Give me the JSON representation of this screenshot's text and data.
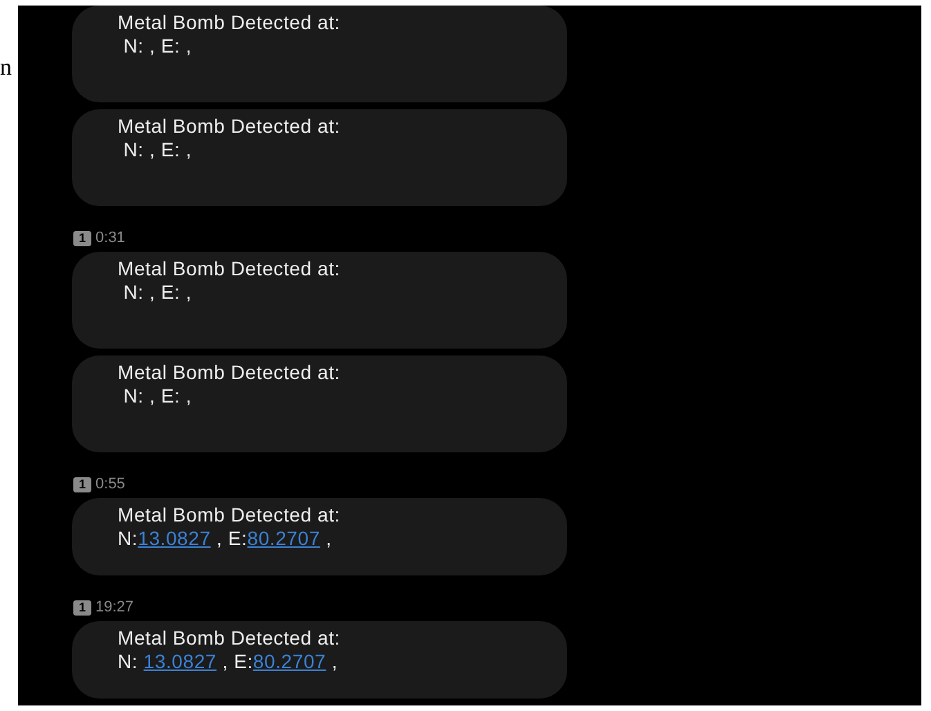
{
  "margin_text": "n",
  "messages": [
    {
      "text": "Metal Bomb Detected at:",
      "coords": [
        {
          "kind": "text",
          "text": " N: , E: ,"
        }
      ]
    },
    {
      "text": "Metal Bomb Detected at:",
      "coords": [
        {
          "kind": "text",
          "text": " N: , E: ,"
        }
      ]
    },
    {
      "sim": "1",
      "time": "0:31",
      "text": "Metal Bomb Detected at:",
      "coords": [
        {
          "kind": "text",
          "text": " N: , E: ,"
        }
      ]
    },
    {
      "text": "Metal Bomb Detected at:",
      "coords": [
        {
          "kind": "text",
          "text": " N: , E: ,"
        }
      ]
    },
    {
      "sim": "1",
      "time": "0:55",
      "text": "Metal Bomb Detected at:",
      "coords": [
        {
          "kind": "text",
          "text": "N:"
        },
        {
          "kind": "link",
          "text": "13.0827"
        },
        {
          "kind": "text",
          "text": " , E:"
        },
        {
          "kind": "link",
          "text": "80.2707"
        },
        {
          "kind": "text",
          "text": " ,"
        }
      ]
    },
    {
      "sim": "1",
      "time": "19:27",
      "text": "Metal Bomb Detected at:",
      "coords": [
        {
          "kind": "text",
          "text": "N: "
        },
        {
          "kind": "link",
          "text": "13.0827"
        },
        {
          "kind": "text",
          "text": " , E:"
        },
        {
          "kind": "link",
          "text": "80.2707"
        },
        {
          "kind": "text",
          "text": " ,"
        }
      ]
    }
  ]
}
